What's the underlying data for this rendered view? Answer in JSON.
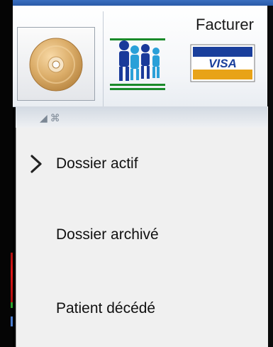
{
  "ribbon": {
    "group_label": "Facturer",
    "app_button_icon": "disc-icon",
    "tools": [
      {
        "name": "team-icon"
      },
      {
        "name": "visa-card-icon",
        "text": "VISA"
      }
    ]
  },
  "menu": {
    "items": [
      {
        "label": "Dossier actif",
        "selected": true
      },
      {
        "label": "Dossier archivé",
        "selected": false
      },
      {
        "label": "Patient décédé",
        "selected": false
      }
    ]
  },
  "colors": {
    "title_bar": "#2a5aa8",
    "menu_bg": "#f0f0f0",
    "edge_red": "#e01818",
    "edge_green": "#2da12d",
    "edge_blue": "#4c7ed0"
  }
}
